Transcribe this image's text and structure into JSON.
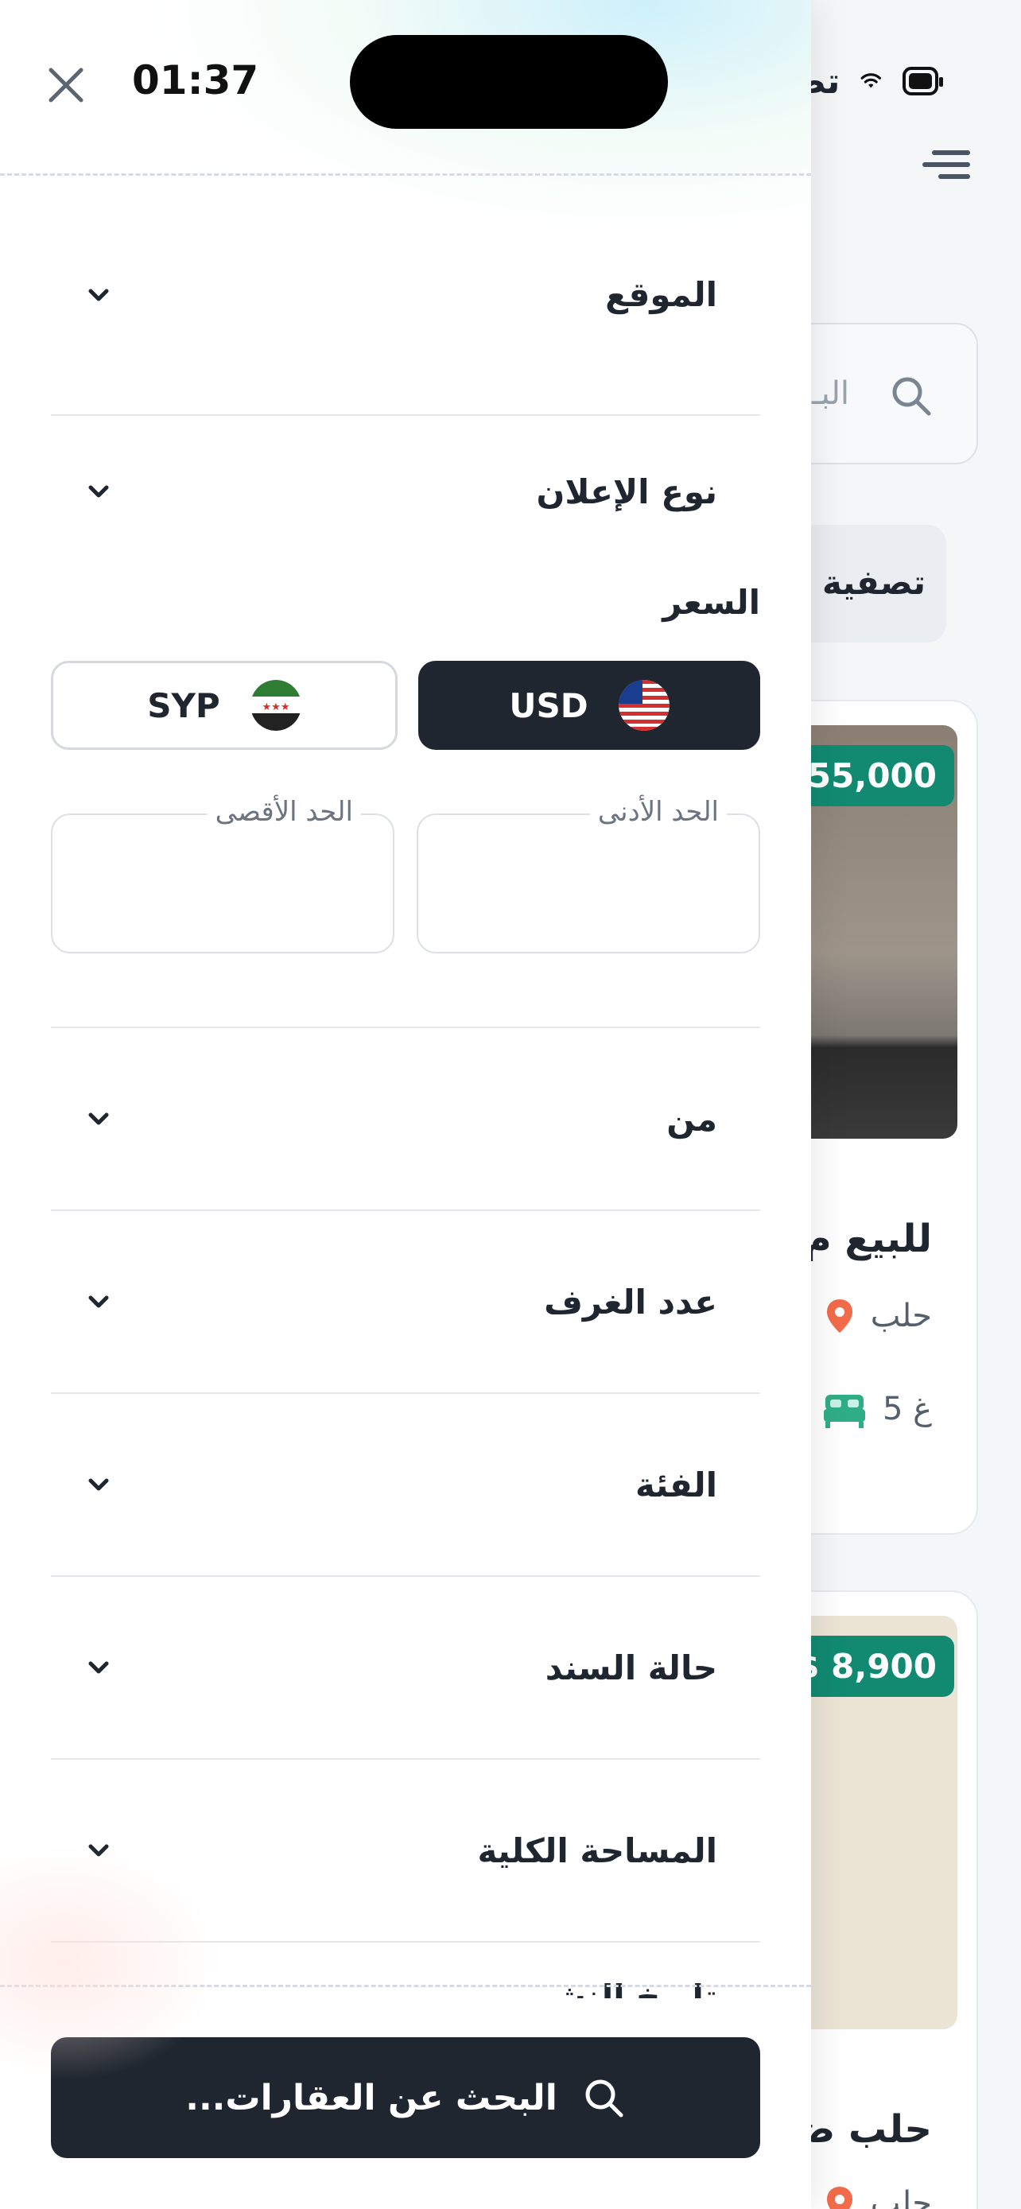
{
  "status_bar": {
    "time": "01:37",
    "bg_title": "تصفية...",
    "icons": [
      "wifi-icon",
      "battery-icon"
    ]
  },
  "background_page": {
    "search_placeholder": "البـ",
    "filter_chip": "تصفية",
    "cards": [
      {
        "price": "55,000",
        "title": "للبيع م",
        "location": "حلب",
        "rooms": "5 غ"
      },
      {
        "price": "$ 8,900",
        "title": "حلب ض",
        "location": "حلب"
      }
    ]
  },
  "drawer": {
    "close_icon": "close-icon",
    "filters": {
      "location": "الموقع",
      "ad_type": "نوع الإعلان",
      "price": "السعر",
      "from": "من",
      "rooms": "عدد الغرف",
      "category": "الفئة",
      "deed_status": "حالة السند",
      "total_area": "المساحة الكلية",
      "publish_date": "تاريخ النشر"
    },
    "currency": {
      "selected": "USD",
      "options": [
        "USD",
        "SYP"
      ]
    },
    "range": {
      "min_label": "الحد الأدنى",
      "max_label": "الحد الأقصى"
    },
    "search_button": "البحث عن العقارات..."
  },
  "colors": {
    "primary_dark": "#1f2630",
    "price_tag_green": "#128a72",
    "pin_orange": "#f26b4a",
    "bed_green": "#2fae85"
  }
}
